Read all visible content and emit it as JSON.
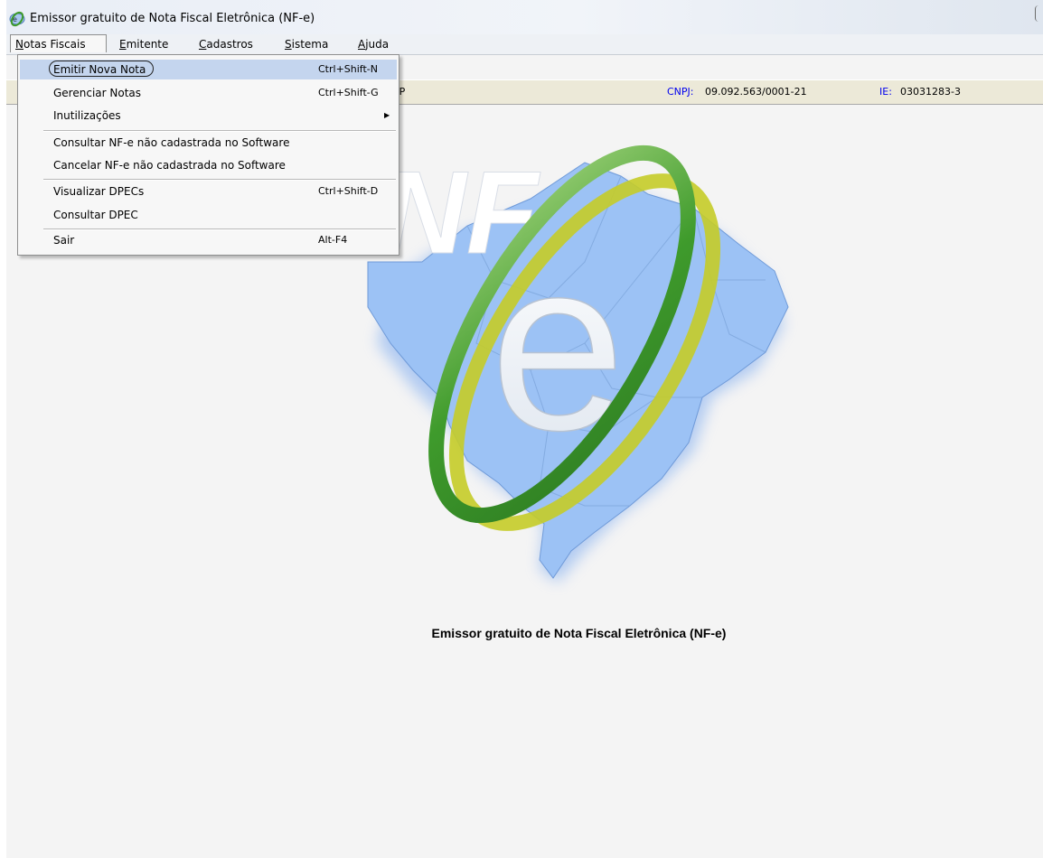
{
  "window": {
    "title": "Emissor gratuito de Nota Fiscal Eletrônica (NF-e)",
    "icon": "nfe-app-icon"
  },
  "menubar": [
    {
      "label": "Notas Fiscais",
      "mnemonic": "N",
      "active": true
    },
    {
      "label": "Emitente",
      "mnemonic": "E"
    },
    {
      "label": "Cadastros",
      "mnemonic": "C"
    },
    {
      "label": "Sistema",
      "mnemonic": "S"
    },
    {
      "label": "Ajuda",
      "mnemonic": "A"
    }
  ],
  "dropdown": {
    "items": [
      {
        "label": "Emitir Nova Nota",
        "shortcut": "Ctrl+Shift-N",
        "highlighted": true,
        "circled": true
      },
      {
        "label": "Gerenciar Notas",
        "shortcut": "Ctrl+Shift-G"
      },
      {
        "label": "Inutilizações",
        "submenu": true
      },
      {
        "label": "Consultar NF-e não cadastrada no Software"
      },
      {
        "label": "Cancelar NF-e não cadastrada no Software"
      },
      {
        "label": "Visualizar DPECs",
        "shortcut": "Ctrl+Shift-D"
      },
      {
        "label": "Consultar DPEC"
      },
      {
        "label": "Sair",
        "shortcut": "Alt-F4"
      }
    ],
    "submenu_arrow": "▶"
  },
  "infobar": {
    "truncated_text": "PP",
    "cnpj_label": "CNPJ:",
    "cnpj_value": "09.092.563/0001-21",
    "ie_label": "IE:",
    "ie_value": "03031283-3"
  },
  "logo": {
    "text_nf": "NF",
    "text_e": "e",
    "caption": "Emissor gratuito de Nota Fiscal Eletrônica (NF-e)"
  },
  "colors": {
    "highlight": "#c4d5ee",
    "map_blue": "#8fb8f2",
    "ring_green": "#3d9a2a",
    "ring_yellow": "#c7cc2a",
    "label_blue": "#0000ee"
  }
}
